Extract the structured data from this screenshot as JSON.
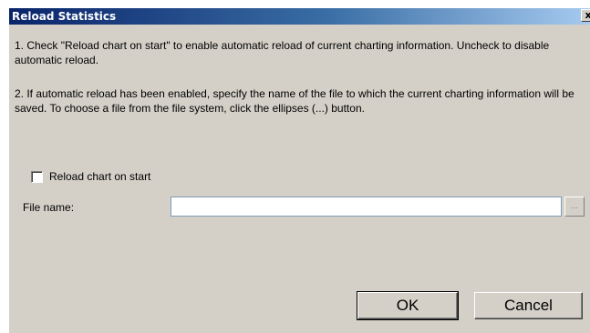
{
  "dialog": {
    "title": "Reload Statistics",
    "close_glyph": "x",
    "instructions": [
      "1. Check \"Reload chart on start\" to enable automatic reload of current charting information. Uncheck to disable automatic reload.",
      "2. If automatic reload has been enabled, specify the name of the file to which the current charting information will be saved. To choose a file from the file system, click the ellipses (...) button."
    ],
    "reload_checkbox": {
      "label": "Reload chart on start",
      "checked": false
    },
    "file_name": {
      "label": "File name:",
      "value": "",
      "browse_label": "..."
    },
    "buttons": {
      "ok": "OK",
      "cancel": "Cancel"
    }
  },
  "colors": {
    "dialog_background": "#d4d0c8",
    "title_gradient_start": "#0a246a",
    "title_gradient_end": "#a6caf0",
    "title_text": "#ffffff"
  },
  "icons": {
    "close": "close-icon"
  }
}
